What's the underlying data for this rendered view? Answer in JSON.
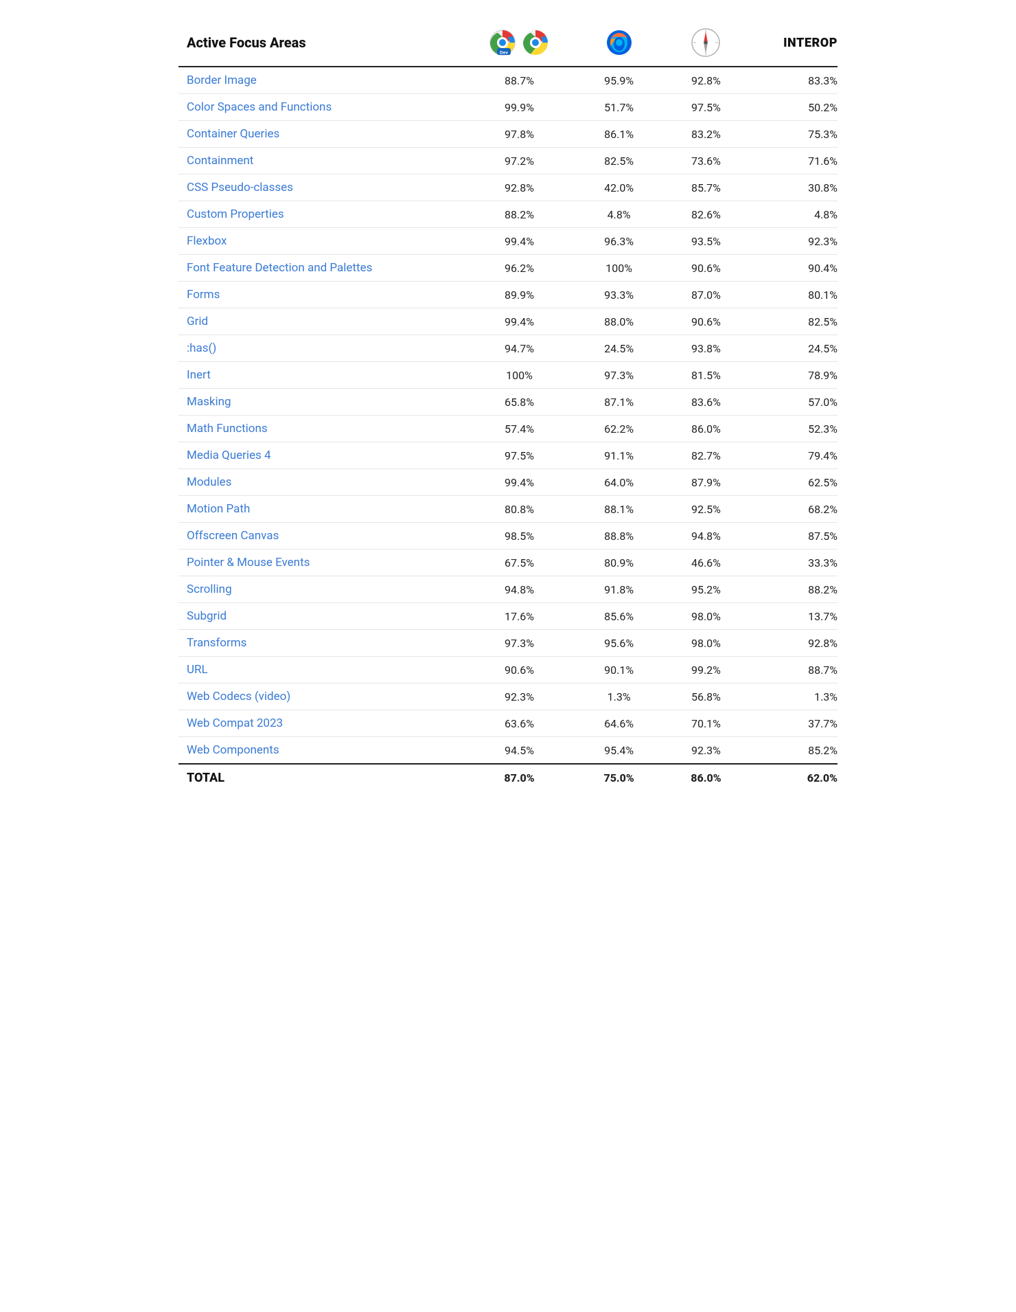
{
  "header": {
    "area_label": "Active Focus Areas",
    "interop_label": "INTEROP"
  },
  "rows": [
    {
      "name": "Border Image",
      "col1": "88.7%",
      "col2": "95.9%",
      "col3": "92.8%",
      "col4": "83.3%"
    },
    {
      "name": "Color Spaces and Functions",
      "col1": "99.9%",
      "col2": "51.7%",
      "col3": "97.5%",
      "col4": "50.2%"
    },
    {
      "name": "Container Queries",
      "col1": "97.8%",
      "col2": "86.1%",
      "col3": "83.2%",
      "col4": "75.3%"
    },
    {
      "name": "Containment",
      "col1": "97.2%",
      "col2": "82.5%",
      "col3": "73.6%",
      "col4": "71.6%"
    },
    {
      "name": "CSS Pseudo-classes",
      "col1": "92.8%",
      "col2": "42.0%",
      "col3": "85.7%",
      "col4": "30.8%"
    },
    {
      "name": "Custom Properties",
      "col1": "88.2%",
      "col2": "4.8%",
      "col3": "82.6%",
      "col4": "4.8%"
    },
    {
      "name": "Flexbox",
      "col1": "99.4%",
      "col2": "96.3%",
      "col3": "93.5%",
      "col4": "92.3%"
    },
    {
      "name": "Font Feature Detection and Palettes",
      "col1": "96.2%",
      "col2": "100%",
      "col3": "90.6%",
      "col4": "90.4%"
    },
    {
      "name": "Forms",
      "col1": "89.9%",
      "col2": "93.3%",
      "col3": "87.0%",
      "col4": "80.1%"
    },
    {
      "name": "Grid",
      "col1": "99.4%",
      "col2": "88.0%",
      "col3": "90.6%",
      "col4": "82.5%"
    },
    {
      "name": ":has()",
      "col1": "94.7%",
      "col2": "24.5%",
      "col3": "93.8%",
      "col4": "24.5%"
    },
    {
      "name": "Inert",
      "col1": "100%",
      "col2": "97.3%",
      "col3": "81.5%",
      "col4": "78.9%"
    },
    {
      "name": "Masking",
      "col1": "65.8%",
      "col2": "87.1%",
      "col3": "83.6%",
      "col4": "57.0%"
    },
    {
      "name": "Math Functions",
      "col1": "57.4%",
      "col2": "62.2%",
      "col3": "86.0%",
      "col4": "52.3%"
    },
    {
      "name": "Media Queries 4",
      "col1": "97.5%",
      "col2": "91.1%",
      "col3": "82.7%",
      "col4": "79.4%"
    },
    {
      "name": "Modules",
      "col1": "99.4%",
      "col2": "64.0%",
      "col3": "87.9%",
      "col4": "62.5%"
    },
    {
      "name": "Motion Path",
      "col1": "80.8%",
      "col2": "88.1%",
      "col3": "92.5%",
      "col4": "68.2%"
    },
    {
      "name": "Offscreen Canvas",
      "col1": "98.5%",
      "col2": "88.8%",
      "col3": "94.8%",
      "col4": "87.5%"
    },
    {
      "name": "Pointer & Mouse Events",
      "col1": "67.5%",
      "col2": "80.9%",
      "col3": "46.6%",
      "col4": "33.3%"
    },
    {
      "name": "Scrolling",
      "col1": "94.8%",
      "col2": "91.8%",
      "col3": "95.2%",
      "col4": "88.2%"
    },
    {
      "name": "Subgrid",
      "col1": "17.6%",
      "col2": "85.6%",
      "col3": "98.0%",
      "col4": "13.7%"
    },
    {
      "name": "Transforms",
      "col1": "97.3%",
      "col2": "95.6%",
      "col3": "98.0%",
      "col4": "92.8%"
    },
    {
      "name": "URL",
      "col1": "90.6%",
      "col2": "90.1%",
      "col3": "99.2%",
      "col4": "88.7%"
    },
    {
      "name": "Web Codecs (video)",
      "col1": "92.3%",
      "col2": "1.3%",
      "col3": "56.8%",
      "col4": "1.3%"
    },
    {
      "name": "Web Compat 2023",
      "col1": "63.6%",
      "col2": "64.6%",
      "col3": "70.1%",
      "col4": "37.7%"
    },
    {
      "name": "Web Components",
      "col1": "94.5%",
      "col2": "95.4%",
      "col3": "92.3%",
      "col4": "85.2%"
    }
  ],
  "total": {
    "name": "TOTAL",
    "col1": "87.0%",
    "col2": "75.0%",
    "col3": "86.0%",
    "col4": "62.0%"
  }
}
